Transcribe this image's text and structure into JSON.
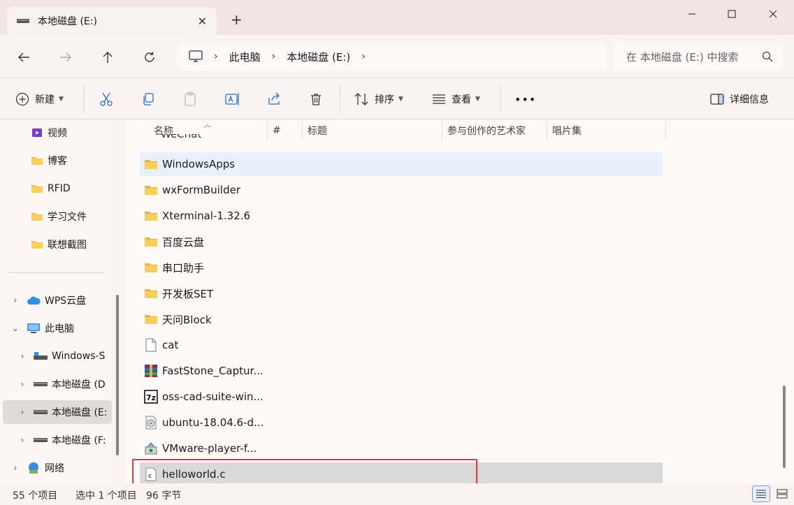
{
  "window": {
    "tab_title": "本地磁盘 (E:)",
    "tab_close": "✕",
    "new_tab": "+",
    "minimize": "—",
    "maximize": "▢",
    "close": "✕"
  },
  "nav": {
    "breadcrumb": [
      "此电脑",
      "本地磁盘 (E:)"
    ],
    "search_placeholder": "在 本地磁盘 (E:) 中搜索"
  },
  "toolbar": {
    "new_label": "新建",
    "sort_label": "排序",
    "view_label": "查看",
    "more_label": "•••",
    "details_label": "详细信息"
  },
  "sidebar": {
    "quick_items": [
      {
        "label": "视频",
        "icon": "video-icon",
        "pinned": true
      },
      {
        "label": "博客",
        "icon": "folder-icon"
      },
      {
        "label": "RFID",
        "icon": "folder-icon"
      },
      {
        "label": "学习文件",
        "icon": "folder-icon"
      },
      {
        "label": "联想截图",
        "icon": "folder-icon"
      }
    ],
    "tree": [
      {
        "label": "WPS云盘",
        "icon": "cloud-icon",
        "arrow": "›",
        "level": 0
      },
      {
        "label": "此电脑",
        "icon": "computer-icon",
        "arrow": "⌄",
        "level": 0
      },
      {
        "label": "Windows-S",
        "icon": "drive-icon",
        "arrow": "›",
        "level": 1
      },
      {
        "label": "本地磁盘 (D",
        "icon": "drive-icon",
        "arrow": "›",
        "level": 1
      },
      {
        "label": "本地磁盘 (E:",
        "icon": "drive-icon",
        "arrow": "›",
        "level": 1,
        "selected": true
      },
      {
        "label": "本地磁盘 (F:",
        "icon": "drive-icon",
        "arrow": "›",
        "level": 1
      },
      {
        "label": "网络",
        "icon": "network-icon",
        "arrow": "›",
        "level": 0
      }
    ]
  },
  "columns": [
    "名称",
    "#",
    "标题",
    "参与创作的艺术家",
    "唱片集"
  ],
  "partial_row": "WeChat",
  "files": [
    {
      "name": "WindowsApps",
      "icon": "folder-icon",
      "state": "hover"
    },
    {
      "name": "wxFormBuilder",
      "icon": "folder-icon"
    },
    {
      "name": "Xterminal-1.32.6",
      "icon": "folder-icon"
    },
    {
      "name": "百度云盘",
      "icon": "folder-icon"
    },
    {
      "name": "串口助手",
      "icon": "folder-icon"
    },
    {
      "name": "开发板SET",
      "icon": "folder-icon"
    },
    {
      "name": "天问Block",
      "icon": "folder-icon"
    },
    {
      "name": "cat",
      "icon": "file-icon"
    },
    {
      "name": "FastStone_Captur...",
      "icon": "archive-icon"
    },
    {
      "name": "oss-cad-suite-win...",
      "icon": "7z-icon"
    },
    {
      "name": "ubuntu-18.04.6-d...",
      "icon": "disc-image-icon"
    },
    {
      "name": "VMware-player-f...",
      "icon": "installer-icon"
    },
    {
      "name": "helloworld.c",
      "icon": "c-file-icon",
      "state": "selected"
    }
  ],
  "status": {
    "item_count": "55 个项目",
    "selection": "选中 1 个项目",
    "size": "96 字节"
  },
  "colors": {
    "accent_highlight": "#e43b2c",
    "folder_yellow": "#f4c242",
    "hover_blue": "#e8f1fb"
  }
}
